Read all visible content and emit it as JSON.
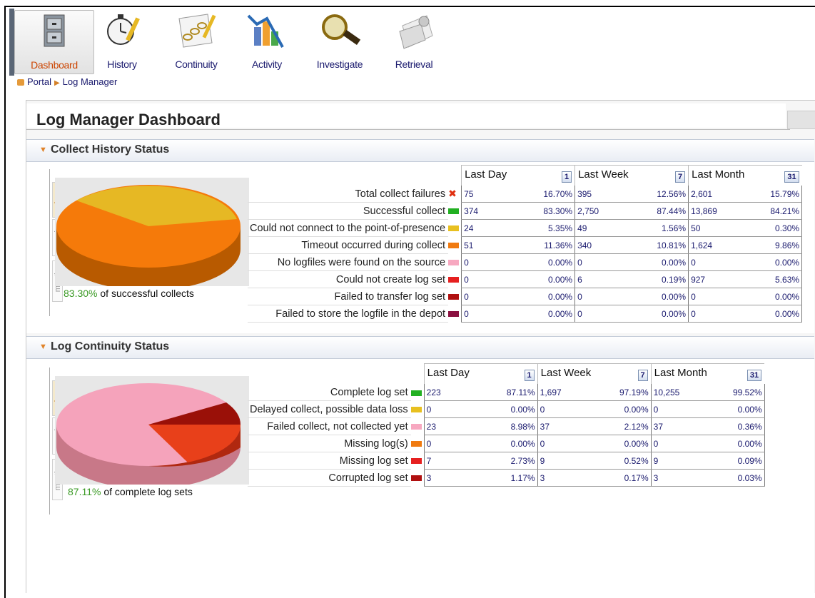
{
  "toolbar": {
    "items": [
      {
        "label": "Dashboard",
        "icon": "dashboard-cabinet-icon"
      },
      {
        "label": "History",
        "icon": "history-stopwatch-icon"
      },
      {
        "label": "Continuity",
        "icon": "continuity-chain-icon"
      },
      {
        "label": "Activity",
        "icon": "activity-chart-icon"
      },
      {
        "label": "Investigate",
        "icon": "investigate-magnifier-icon"
      },
      {
        "label": "Retrieval",
        "icon": "retrieval-document-icon"
      }
    ]
  },
  "breadcrumb": {
    "portal": "Portal",
    "current": "Log Manager"
  },
  "dashboard": {
    "title": "Log Manager Dashboard"
  },
  "colors": {
    "accent": "#e0832a",
    "link_text": "#1a1a6e",
    "positive_pct": "#3a9a24"
  },
  "tabs": {
    "day": "day",
    "week": "week",
    "month": "month"
  },
  "columns": {
    "last_day": "Last Day",
    "last_day_icon": "1",
    "last_week": "Last Week",
    "last_week_icon": "7",
    "last_month": "Last Month",
    "last_month_icon": "31"
  },
  "collect": {
    "title": "Collect History Status",
    "caption_pct": "83.30%",
    "caption_text": " of successful collects",
    "pie": [
      {
        "label": "Successful collect",
        "value": 83.3,
        "color": "#f0760a"
      },
      {
        "label": "Could not connect to the point-of-presence",
        "value": 5.35,
        "color": "#e6b824"
      },
      {
        "label": "Timeout occurred during collect",
        "value": 11.36,
        "color": "#e6b824"
      }
    ],
    "rows": [
      {
        "label": "Total collect failures",
        "swatch": "x",
        "day_n": "75",
        "day_p": "16.70%",
        "week_n": "395",
        "week_p": "12.56%",
        "month_n": "2,601",
        "month_p": "15.79%"
      },
      {
        "label": "Successful collect",
        "swatch": "#22b022",
        "day_n": "374",
        "day_p": "83.30%",
        "week_n": "2,750",
        "week_p": "87.44%",
        "month_n": "13,869",
        "month_p": "84.21%"
      },
      {
        "label": "Could not connect to the point-of-presence",
        "swatch": "#e8c020",
        "day_n": "24",
        "day_p": "5.35%",
        "week_n": "49",
        "week_p": "1.56%",
        "month_n": "50",
        "month_p": "0.30%"
      },
      {
        "label": "Timeout occurred during collect",
        "swatch": "#f07a10",
        "day_n": "51",
        "day_p": "11.36%",
        "week_n": "340",
        "week_p": "10.81%",
        "month_n": "1,624",
        "month_p": "9.86%"
      },
      {
        "label": "No logfiles were found on the source",
        "swatch": "#f7a8c0",
        "day_n": "0",
        "day_p": "0.00%",
        "week_n": "0",
        "week_p": "0.00%",
        "month_n": "0",
        "month_p": "0.00%"
      },
      {
        "label": "Could not create log set",
        "swatch": "#e62020",
        "day_n": "0",
        "day_p": "0.00%",
        "week_n": "6",
        "week_p": "0.19%",
        "month_n": "927",
        "month_p": "5.63%"
      },
      {
        "label": "Failed to transfer log set",
        "swatch": "#b01010",
        "day_n": "0",
        "day_p": "0.00%",
        "week_n": "0",
        "week_p": "0.00%",
        "month_n": "0",
        "month_p": "0.00%"
      },
      {
        "label": "Failed to store the logfile in the depot",
        "swatch": "#8a1040",
        "day_n": "0",
        "day_p": "0.00%",
        "week_n": "0",
        "week_p": "0.00%",
        "month_n": "0",
        "month_p": "0.00%"
      }
    ]
  },
  "continuity": {
    "title": "Log Continuity Status",
    "caption_pct": "87.11%",
    "caption_text": " of complete log sets",
    "pie": [
      {
        "label": "Complete log set",
        "value": 87.11,
        "color": "#f5a3bb"
      },
      {
        "label": "Failed collect, not collected yet",
        "value": 8.98,
        "color": "#e8401a"
      },
      {
        "label": "Missing log set",
        "value": 2.73,
        "color": "#c02010"
      },
      {
        "label": "Corrupted log set",
        "value": 1.17,
        "color": "#9a1008"
      }
    ],
    "rows": [
      {
        "label": "Complete log set",
        "swatch": "#22b022",
        "day_n": "223",
        "day_p": "87.11%",
        "week_n": "1,697",
        "week_p": "97.19%",
        "month_n": "10,255",
        "month_p": "99.52%"
      },
      {
        "label": "Delayed collect, possible data loss",
        "swatch": "#e8c020",
        "day_n": "0",
        "day_p": "0.00%",
        "week_n": "0",
        "week_p": "0.00%",
        "month_n": "0",
        "month_p": "0.00%"
      },
      {
        "label": "Failed collect, not collected yet",
        "swatch": "#f7a8c0",
        "day_n": "23",
        "day_p": "8.98%",
        "week_n": "37",
        "week_p": "2.12%",
        "month_n": "37",
        "month_p": "0.36%"
      },
      {
        "label": "Missing log(s)",
        "swatch": "#f07a10",
        "day_n": "0",
        "day_p": "0.00%",
        "week_n": "0",
        "week_p": "0.00%",
        "month_n": "0",
        "month_p": "0.00%"
      },
      {
        "label": "Missing log set",
        "swatch": "#e62020",
        "day_n": "7",
        "day_p": "2.73%",
        "week_n": "9",
        "week_p": "0.52%",
        "month_n": "9",
        "month_p": "0.09%"
      },
      {
        "label": "Corrupted log set",
        "swatch": "#b01010",
        "day_n": "3",
        "day_p": "1.17%",
        "week_n": "3",
        "week_p": "0.17%",
        "month_n": "3",
        "month_p": "0.03%"
      }
    ]
  }
}
